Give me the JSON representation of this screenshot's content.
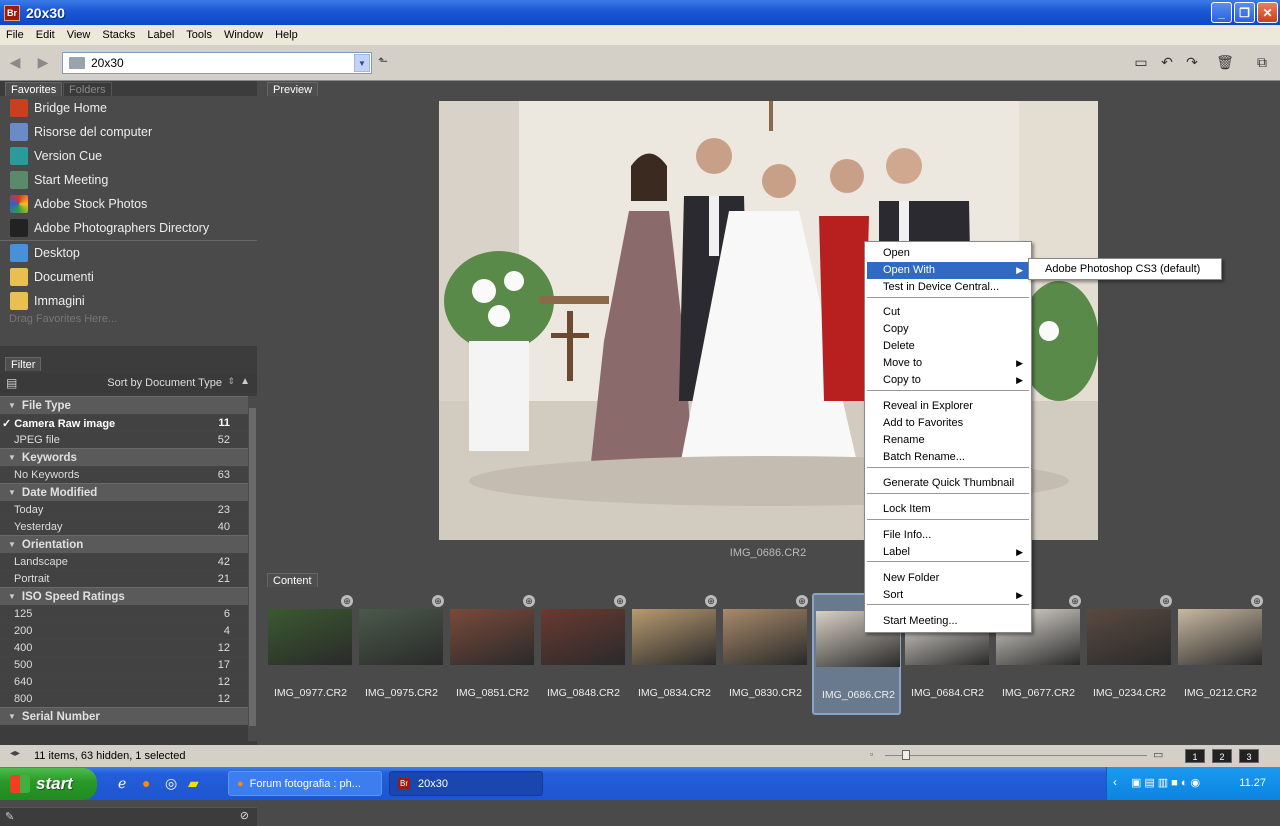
{
  "window": {
    "title": "20x30",
    "app_icon_text": "Br"
  },
  "menu": [
    "File",
    "Edit",
    "View",
    "Stacks",
    "Label",
    "Tools",
    "Window",
    "Help"
  ],
  "toolbar": {
    "path": "20x30"
  },
  "favorites": {
    "tabs": [
      "Favorites",
      "Folders"
    ],
    "items": [
      "Bridge Home",
      "Risorse del computer",
      "Version Cue",
      "Start Meeting",
      "Adobe Stock Photos",
      "Adobe Photographers Directory"
    ],
    "folders": [
      "Desktop",
      "Documenti",
      "Immagini"
    ],
    "drag_hint": "Drag Favorites Here..."
  },
  "filter": {
    "tab": "Filter",
    "sort_label": "Sort by Document Type",
    "categories": [
      {
        "name": "File Type",
        "rows": [
          [
            "Camera Raw image",
            "11"
          ],
          [
            "JPEG file",
            "52"
          ]
        ]
      },
      {
        "name": "Keywords",
        "rows": [
          [
            "No Keywords",
            "63"
          ]
        ]
      },
      {
        "name": "Date Modified",
        "rows": [
          [
            "Today",
            "23"
          ],
          [
            "Yesterday",
            "40"
          ]
        ]
      },
      {
        "name": "Orientation",
        "rows": [
          [
            "Landscape",
            "42"
          ],
          [
            "Portrait",
            "21"
          ]
        ]
      },
      {
        "name": "ISO Speed Ratings",
        "rows": [
          [
            "125",
            "6"
          ],
          [
            "200",
            "4"
          ],
          [
            "400",
            "12"
          ],
          [
            "500",
            "17"
          ],
          [
            "640",
            "12"
          ],
          [
            "800",
            "12"
          ]
        ]
      },
      {
        "name": "Serial Number",
        "rows": []
      }
    ]
  },
  "preview": {
    "tab": "Preview",
    "caption": "IMG_0686.CR2"
  },
  "content": {
    "tab": "Content",
    "thumbnails": [
      "IMG_0977.CR2",
      "IMG_0975.CR2",
      "IMG_0851.CR2",
      "IMG_0848.CR2",
      "IMG_0834.CR2",
      "IMG_0830.CR2",
      "IMG_0686.CR2",
      "IMG_0684.CR2",
      "IMG_0677.CR2",
      "IMG_0234.CR2",
      "IMG_0212.CR2"
    ],
    "selected_index": 6
  },
  "status": {
    "text": "11 items, 63 hidden, 1 selected",
    "view_buttons": [
      "1",
      "2",
      "3"
    ]
  },
  "taskbar": {
    "start": "start",
    "tasks": [
      "Forum fotografia : ph...",
      "20x30"
    ],
    "clock": "11.27"
  },
  "context_menu": {
    "items": [
      "Open",
      "Open With",
      "Test in Device Central...",
      "Cut",
      "Copy",
      "Delete",
      "Move to",
      "Copy to",
      "Reveal in Explorer",
      "Add to Favorites",
      "Rename",
      "Batch Rename...",
      "Generate Quick Thumbnail",
      "Lock Item",
      "File Info...",
      "Label",
      "New Folder",
      "Sort",
      "Start Meeting..."
    ],
    "highlighted": "Open With",
    "submenu": [
      "Adobe Photoshop CS3 (default)"
    ]
  },
  "colors": {
    "selection": "#316ac5",
    "panel": "#4a4a4a",
    "titlebar": "#0a48c8"
  }
}
